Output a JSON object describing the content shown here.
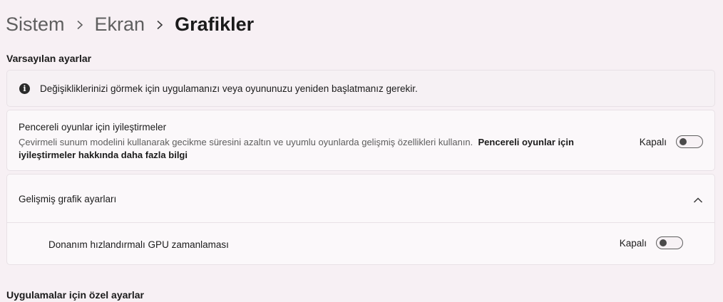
{
  "breadcrumb": {
    "items": [
      "Sistem",
      "Ekran",
      "Grafikler"
    ]
  },
  "sections": {
    "default_settings": "Varsayılan ayarlar",
    "app_settings": "Uygulamalar için özel ayarlar"
  },
  "info": {
    "message": "Değişikliklerinizi görmek için uygulamanızı veya oyununuzu yeniden başlatmanız gerekir.",
    "icon": "info-icon"
  },
  "windowed_games": {
    "title": "Pencereli oyunlar için iyileştirmeler",
    "description": "Çevirmeli sunum modelini kullanarak gecikme süresini azaltın ve uyumlu oyunlarda gelişmiş özellikleri kullanın.",
    "link": "Pencereli oyunlar için iyileştirmeler hakkında daha fazla bilgi",
    "state_label": "Kapalı",
    "enabled": false
  },
  "advanced": {
    "title": "Gelişmiş grafik ayarları",
    "expanded": true,
    "gpu_scheduling": {
      "label": "Donanım hızlandırmalı GPU zamanlaması",
      "state_label": "Kapalı",
      "enabled": false
    }
  },
  "colors": {
    "background": "#f7f0f4",
    "card": "#fbf8fa",
    "border": "#e8e1e6"
  }
}
